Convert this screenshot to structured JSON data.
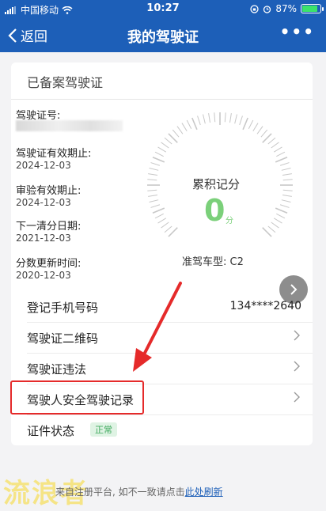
{
  "status_bar": {
    "carrier": "中国移动",
    "time": "10:27",
    "battery": "87%",
    "battery_level": 0.87
  },
  "nav": {
    "back_label": "返回",
    "title": "我的驾驶证",
    "more": "•••"
  },
  "card": {
    "title": "已备案驾驶证",
    "fields": [
      {
        "label": "驾驶证号:",
        "value": ""
      },
      {
        "label": "驾驶证有效期止:",
        "value": "2024-12-03"
      },
      {
        "label": "审验有效期止:",
        "value": "2024-12-03"
      },
      {
        "label": "下一清分日期:",
        "value": "2021-12-03"
      },
      {
        "label": "分数更新时间:",
        "value": "2020-12-03"
      }
    ],
    "gauge": {
      "label": "累积记分",
      "score": "0",
      "unit": "分"
    },
    "vehicle": "准驾车型: C2"
  },
  "rows": [
    {
      "label": "登记手机号码",
      "value": "134****2640"
    },
    {
      "label": "驾驶证二维码"
    },
    {
      "label": "驾驶证违法"
    },
    {
      "label": "驾驶人安全驾驶记录"
    },
    {
      "label": "证件状态",
      "badge": "正常"
    }
  ],
  "footer": {
    "text": "来自注册平台, 如不一致请点击",
    "link": "此处刷新"
  },
  "watermark": "流浪者",
  "colors": {
    "nav": "#1d5fb8",
    "score": "#7bd07a",
    "highlight": "#e52a2a",
    "badge_bg": "#dff3e4"
  }
}
